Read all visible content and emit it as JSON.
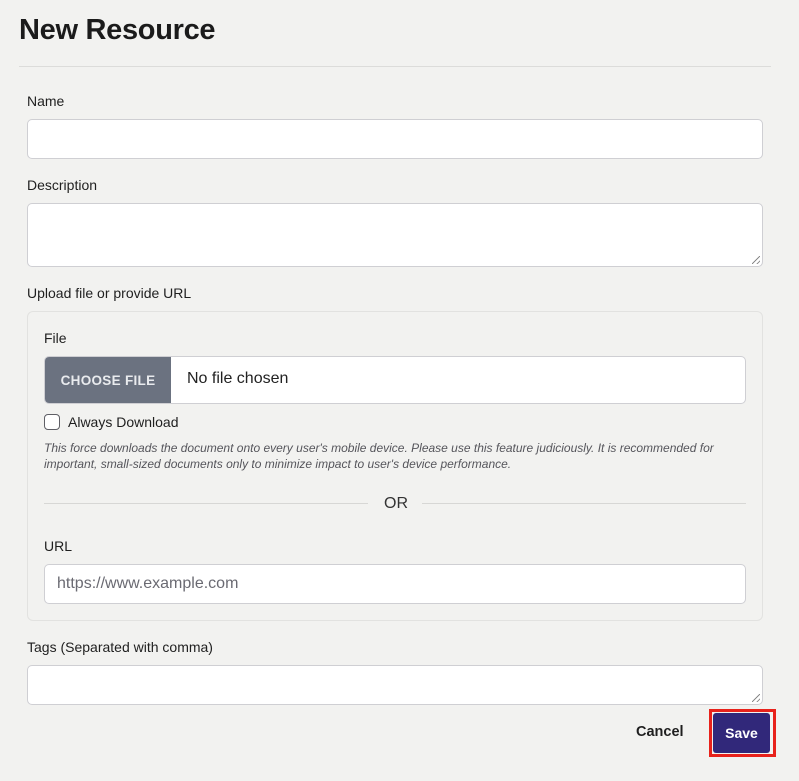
{
  "page": {
    "title": "New Resource"
  },
  "form": {
    "name_label": "Name",
    "name_value": "",
    "description_label": "Description",
    "description_value": "",
    "upload_label": "Upload file or provide URL",
    "file": {
      "label": "File",
      "choose_button": "CHOOSE FILE",
      "status": "No file chosen"
    },
    "always_download": {
      "label": "Always Download",
      "checked": false,
      "help": "This force downloads the document onto every user's mobile device. Please use this feature judiciously. It is recommended for important, small-sized documents only to minimize impact to user's device performance."
    },
    "or_separator": "OR",
    "url_label": "URL",
    "url_placeholder": "https://www.example.com",
    "url_value": "",
    "tags_label": "Tags (Separated with comma)",
    "tags_value": ""
  },
  "actions": {
    "cancel_label": "Cancel",
    "save_label": "Save"
  },
  "colors": {
    "primary_button": "#31287a",
    "highlight": "#e8221b",
    "file_button": "#6b7280",
    "background": "#f2f2f0"
  }
}
